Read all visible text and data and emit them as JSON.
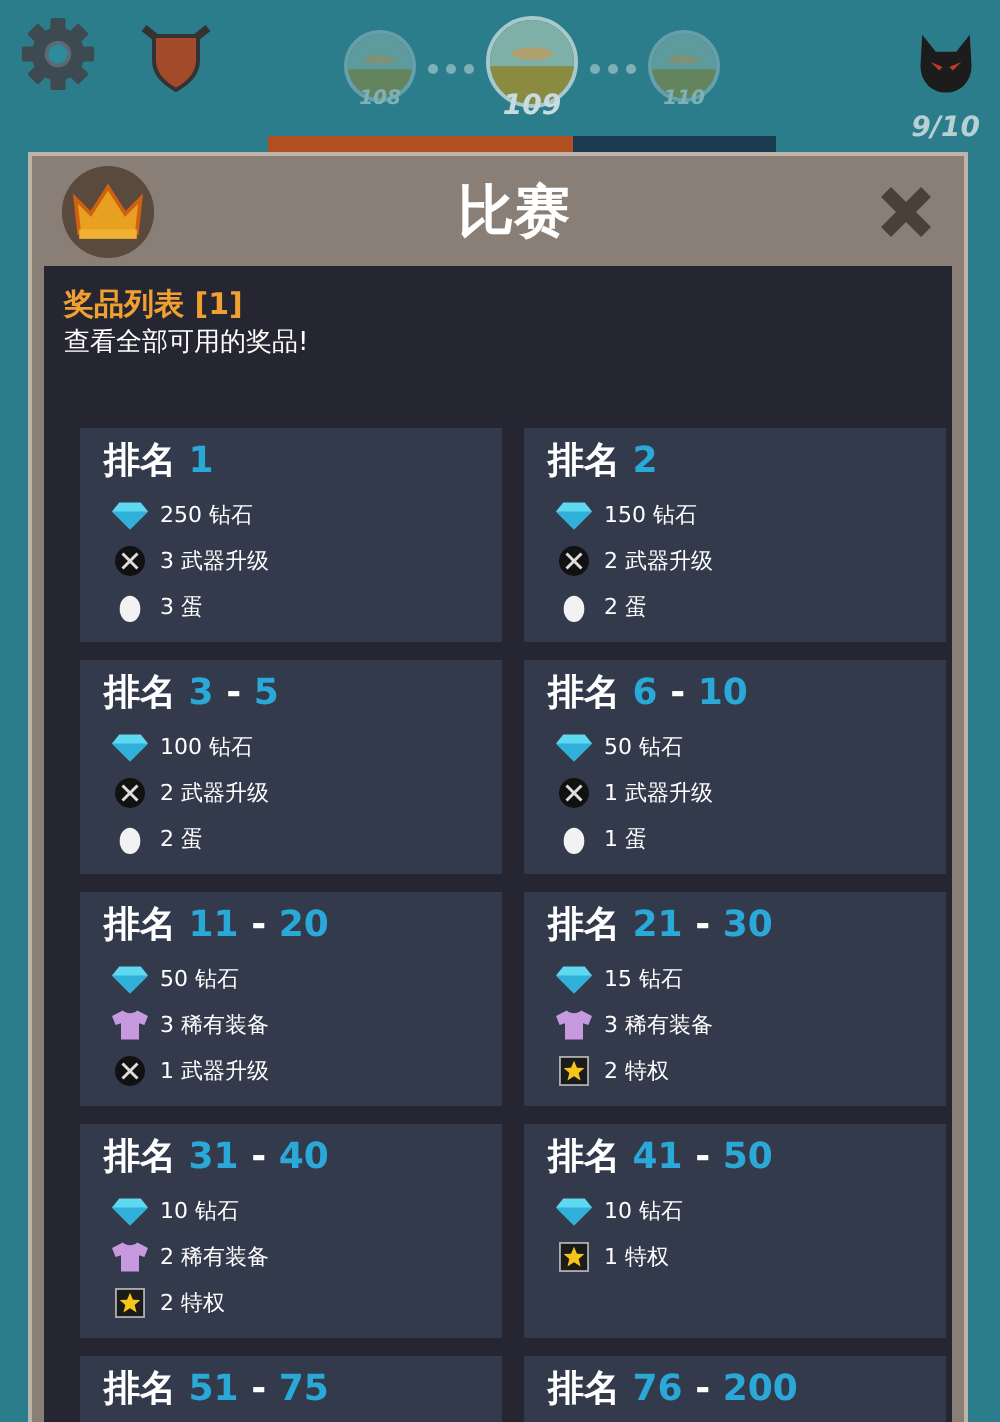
{
  "hud": {
    "levels": [
      {
        "label": "108",
        "selected": false
      },
      {
        "label": "109",
        "selected": true
      },
      {
        "label": "110",
        "selected": false
      }
    ],
    "energy": "9/10"
  },
  "dialog": {
    "title": "比赛",
    "section_title": "奖品列表 [1]",
    "subtitle": "查看全部可用的奖品!",
    "cards": [
      {
        "label": "排名",
        "range": "1",
        "rewards": [
          {
            "kind": "diamond",
            "text": "250 钻石"
          },
          {
            "kind": "weapon",
            "text": "3 武器升级"
          },
          {
            "kind": "egg",
            "text": "3 蛋"
          }
        ]
      },
      {
        "label": "排名",
        "range": "2",
        "rewards": [
          {
            "kind": "diamond",
            "text": "150 钻石"
          },
          {
            "kind": "weapon",
            "text": "2 武器升级"
          },
          {
            "kind": "egg",
            "text": "2 蛋"
          }
        ]
      },
      {
        "label": "排名",
        "range": "3 - 5",
        "rewards": [
          {
            "kind": "diamond",
            "text": "100 钻石"
          },
          {
            "kind": "weapon",
            "text": "2 武器升级"
          },
          {
            "kind": "egg",
            "text": "2 蛋"
          }
        ]
      },
      {
        "label": "排名",
        "range": "6 - 10",
        "rewards": [
          {
            "kind": "diamond",
            "text": "50 钻石"
          },
          {
            "kind": "weapon",
            "text": "1 武器升级"
          },
          {
            "kind": "egg",
            "text": "1 蛋"
          }
        ]
      },
      {
        "label": "排名",
        "range": "11 - 20",
        "rewards": [
          {
            "kind": "diamond",
            "text": "50 钻石"
          },
          {
            "kind": "armor",
            "text": "3 稀有装备"
          },
          {
            "kind": "weapon",
            "text": "1 武器升级"
          }
        ]
      },
      {
        "label": "排名",
        "range": "21 - 30",
        "rewards": [
          {
            "kind": "diamond",
            "text": "15 钻石"
          },
          {
            "kind": "armor",
            "text": "3 稀有装备"
          },
          {
            "kind": "perk",
            "text": "2 特权"
          }
        ]
      },
      {
        "label": "排名",
        "range": "31 - 40",
        "rewards": [
          {
            "kind": "diamond",
            "text": "10 钻石"
          },
          {
            "kind": "armor",
            "text": "2 稀有装备"
          },
          {
            "kind": "perk",
            "text": "2 特权"
          }
        ]
      },
      {
        "label": "排名",
        "range": "41 - 50",
        "rewards": [
          {
            "kind": "diamond",
            "text": "10 钻石"
          },
          {
            "kind": "perk",
            "text": "1 特权"
          }
        ]
      },
      {
        "label": "排名",
        "range": "51 - 75"
      },
      {
        "label": "排名",
        "range": "76 - 200"
      }
    ]
  }
}
